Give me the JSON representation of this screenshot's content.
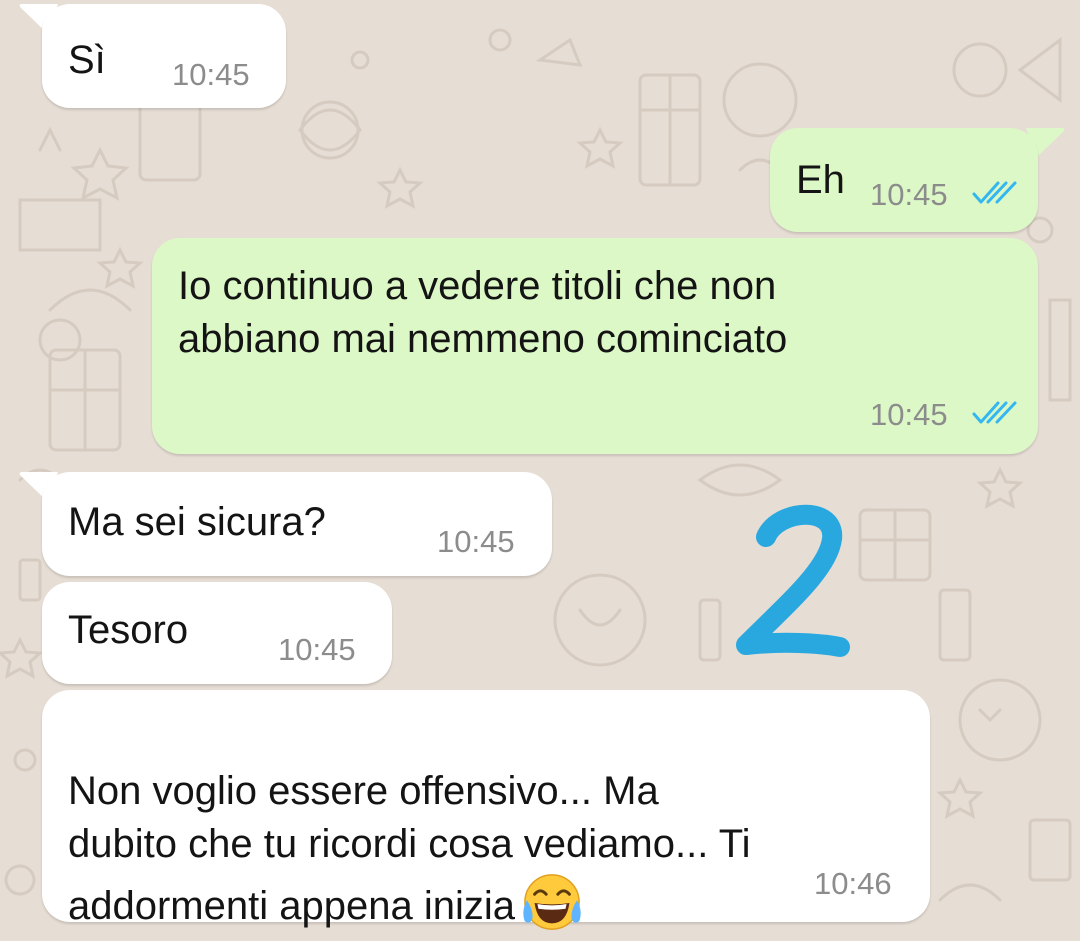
{
  "chat": {
    "messages": [
      {
        "id": "m1",
        "direction": "incoming",
        "text": "Sì",
        "time": "10:45"
      },
      {
        "id": "m2",
        "direction": "outgoing",
        "text": "Eh",
        "time": "10:45",
        "status": "read"
      },
      {
        "id": "m3",
        "direction": "outgoing",
        "text": "Io continuo a vedere titoli che non\nabbiano mai nemmeno cominciato",
        "time": "10:45",
        "status": "read"
      },
      {
        "id": "m4",
        "direction": "incoming",
        "text": "Ma sei sicura?",
        "time": "10:45"
      },
      {
        "id": "m5",
        "direction": "incoming",
        "text": "Tesoro",
        "time": "10:45"
      },
      {
        "id": "m6",
        "direction": "incoming",
        "text": "Non voglio essere offensivo... Ma\ndubito che tu ricordi cosa vediamo... Ti\naddormenti appena inizia",
        "time": "10:46",
        "emoji": "face-with-tears-of-joy"
      }
    ]
  },
  "annotation": {
    "text": "2",
    "color": "#29a8e0"
  },
  "colors": {
    "wallpaper": "#e6ddd4",
    "incoming_bubble": "#ffffff",
    "outgoing_bubble": "#dcf8c6",
    "read_ticks": "#34b7f1",
    "timestamp": "#8c8c8c"
  }
}
